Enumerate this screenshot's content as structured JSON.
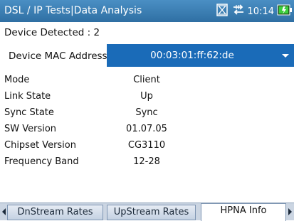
{
  "header": {
    "title": "DSL / IP Tests|Data Analysis",
    "time": "10:14",
    "icons": [
      "hourglass-icon",
      "connection-arrows-icon",
      "battery-icon"
    ],
    "colors": {
      "titlebar": "#3b7fb5",
      "battery": "#3ccf3c"
    }
  },
  "device": {
    "detected_label": "Device Detected : 2",
    "mac_label": "Device MAC Address",
    "mac_value": "00:03:01:ff:62:de",
    "selector_color": "#1a6bb8"
  },
  "info": [
    {
      "key": "Mode",
      "value": "Client"
    },
    {
      "key": "Link State",
      "value": "Up"
    },
    {
      "key": "Sync State",
      "value": "Sync"
    },
    {
      "key": "SW Version",
      "value": "01.07.05"
    },
    {
      "key": "Chipset Version",
      "value": "CG3110"
    },
    {
      "key": "Frequency Band",
      "value": "12-28"
    }
  ],
  "tabs": [
    {
      "label": "DnStream Rates",
      "active": false
    },
    {
      "label": "UpStream Rates",
      "active": false
    },
    {
      "label": "HPNA Info",
      "active": true
    }
  ]
}
